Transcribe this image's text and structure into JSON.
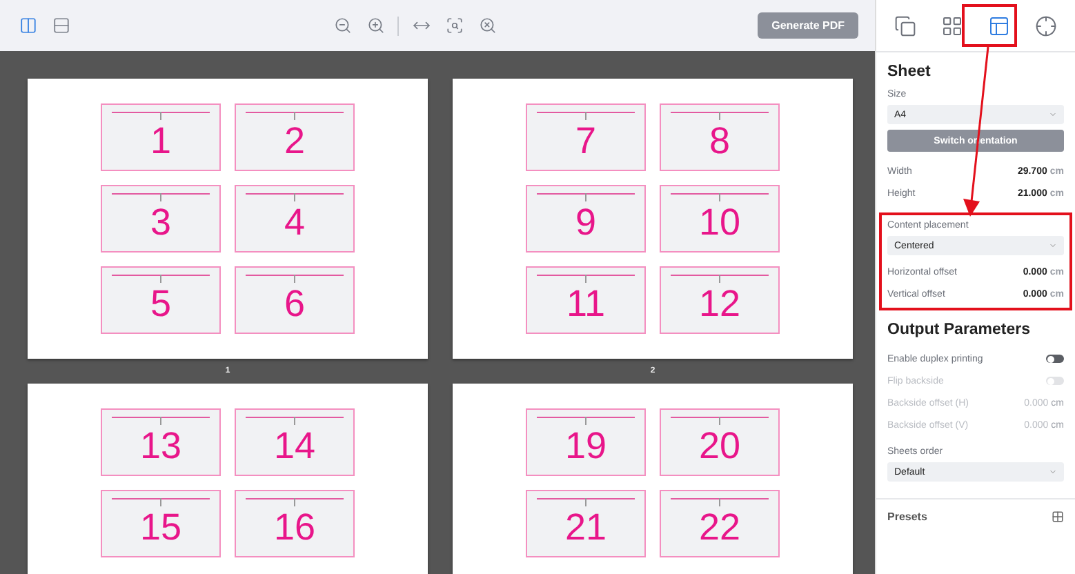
{
  "toolbar": {
    "view_buttons": [
      {
        "kind": "columns",
        "selected": true
      },
      {
        "kind": "rows",
        "selected": false
      }
    ],
    "zoom_tools": [
      {
        "kind": "zoom-out"
      },
      {
        "kind": "zoom-in"
      },
      {
        "kind": "fit-width"
      },
      {
        "kind": "zoom-fit"
      },
      {
        "kind": "zoom-reset"
      }
    ],
    "generate_button": {
      "label": "Generate PDF",
      "disabled": true
    }
  },
  "pages": [
    {
      "label": "1",
      "cards": [
        "1",
        "2",
        "3",
        "4",
        "5",
        "6"
      ]
    },
    {
      "label": "2",
      "cards": [
        "7",
        "8",
        "9",
        "10",
        "11",
        "12"
      ]
    },
    {
      "cards": [
        "13",
        "14",
        "15",
        "16"
      ]
    },
    {
      "cards": [
        "19",
        "20",
        "21",
        "22"
      ]
    }
  ],
  "panel_tabs": [
    {
      "kind": "copies",
      "selected": false
    },
    {
      "kind": "grid",
      "selected": false
    },
    {
      "kind": "layout",
      "selected": true
    },
    {
      "kind": "target",
      "selected": false
    }
  ],
  "sheet": {
    "title": "Sheet",
    "size_label": "Size",
    "size_value": "A4",
    "switch_button": {
      "label": "Switch orientation",
      "disabled": true
    },
    "fields": [
      {
        "label": "Width",
        "value": "29.700",
        "unit": "cm"
      },
      {
        "label": "Height",
        "value": "21.000",
        "unit": "cm"
      }
    ]
  },
  "placement": {
    "label": "Content placement",
    "value": "Centered",
    "highlighted": true,
    "offsets": [
      {
        "label": "Horizontal offset",
        "value": "0.000",
        "unit": "cm"
      },
      {
        "label": "Vertical offset",
        "value": "0.000",
        "unit": "cm"
      }
    ]
  },
  "output": {
    "title": "Output Parameters",
    "rows": [
      {
        "kind": "toggle",
        "label": "Enable duplex printing",
        "on": false,
        "disabled": false
      },
      {
        "kind": "toggle",
        "label": "Flip backside",
        "on": false,
        "disabled": true
      },
      {
        "kind": "value",
        "label": "Backside offset (H)",
        "value": "0.000",
        "unit": "cm",
        "disabled": true
      },
      {
        "kind": "value",
        "label": "Backside offset (V)",
        "value": "0.000",
        "unit": "cm",
        "disabled": true
      }
    ],
    "order_label": "Sheets order",
    "order_value": "Default"
  },
  "presets": {
    "title": "Presets"
  }
}
